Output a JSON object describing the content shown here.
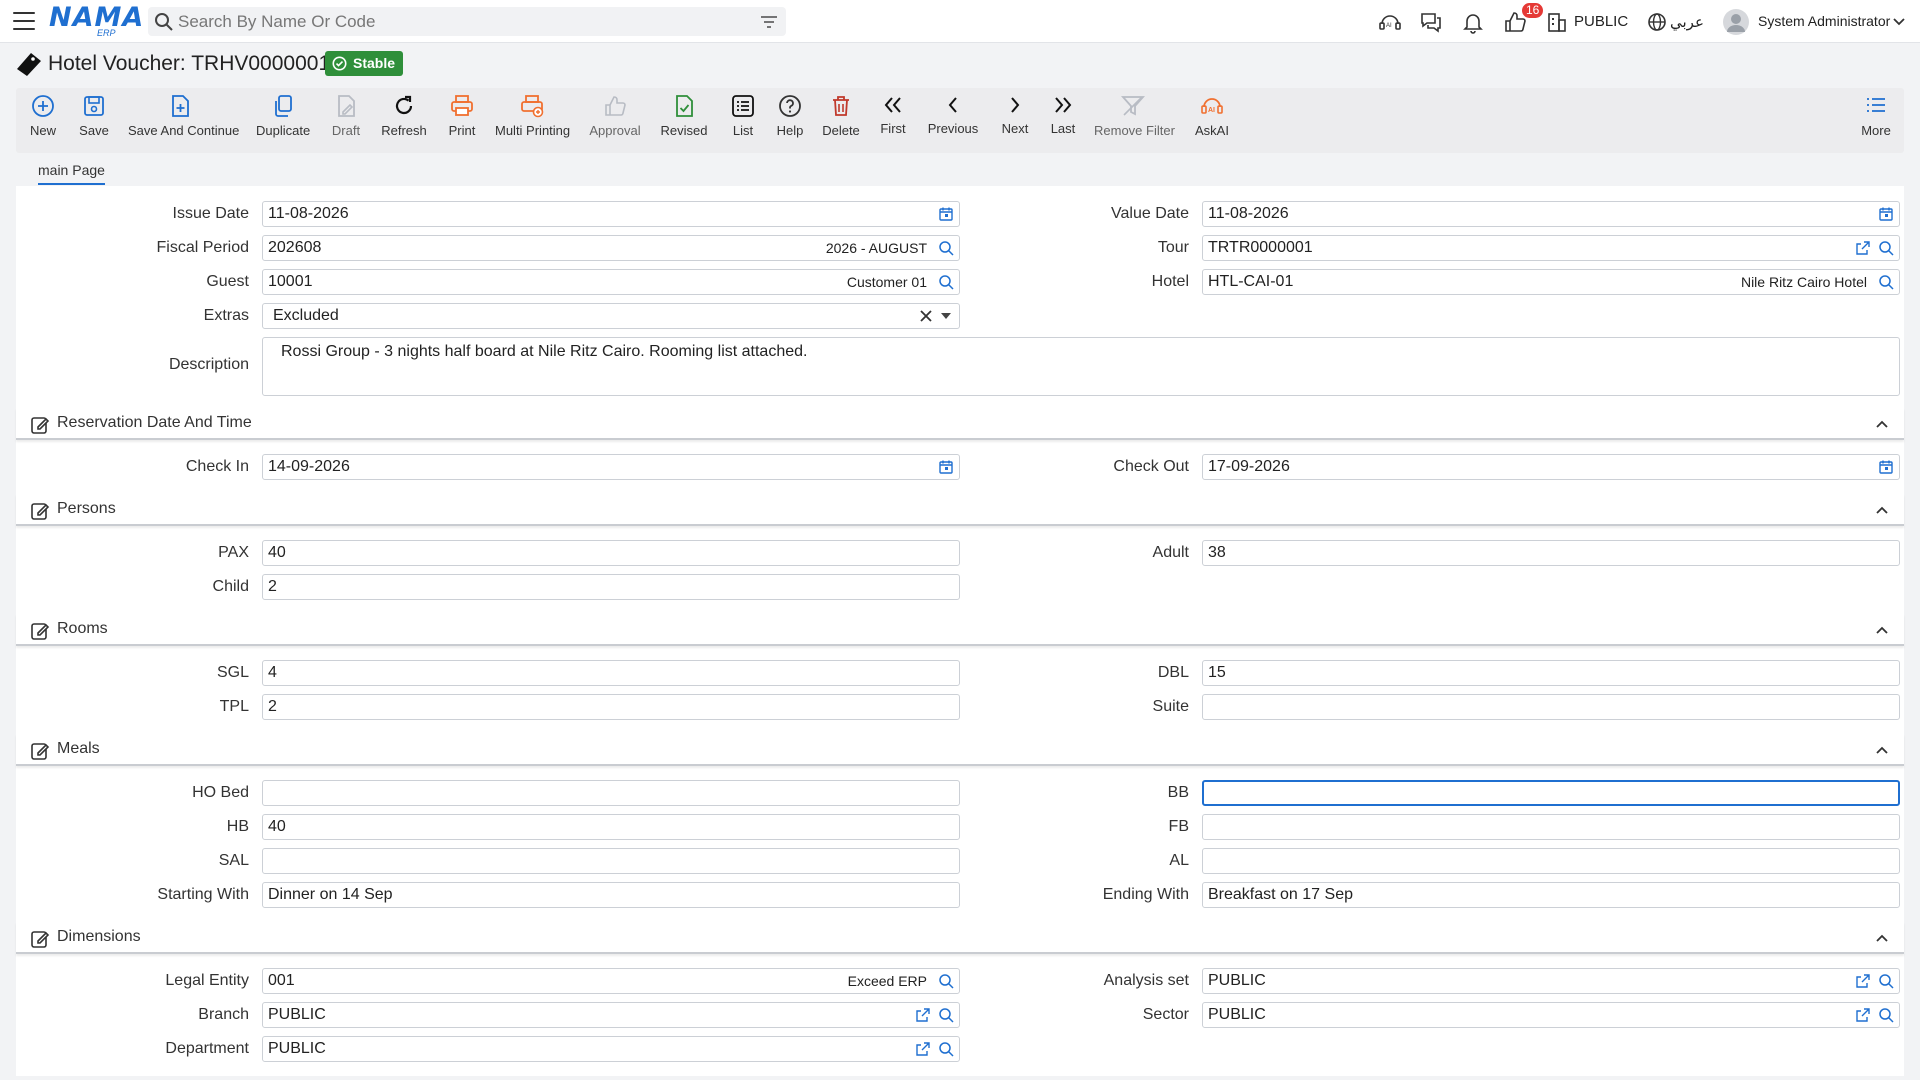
{
  "header": {
    "logo_text": "NAMA",
    "logo_sub": "ERP",
    "search_placeholder": "Search By Name Or Code",
    "notification_count": "16",
    "analysis_set_label": "PUBLIC",
    "language_label": "عربي",
    "user_name": "System Administrator"
  },
  "page": {
    "title": "Hotel Voucher: TRHV0000001",
    "status": "Stable"
  },
  "toolbar": {
    "new": "New",
    "save": "Save",
    "save_continue": "Save And Continue",
    "duplicate": "Duplicate",
    "draft": "Draft",
    "refresh": "Refresh",
    "print": "Print",
    "multi_printing": "Multi Printing",
    "approval": "Approval",
    "revised": "Revised",
    "list": "List",
    "help": "Help",
    "delete": "Delete",
    "first": "First",
    "previous": "Previous",
    "next": "Next",
    "last": "Last",
    "remove_filter": "Remove Filter",
    "askai": "AskAI",
    "more": "More"
  },
  "tabs": {
    "main": "main Page"
  },
  "general": {
    "issue_date_label": "Issue Date",
    "issue_date": "11-08-2026",
    "value_date_label": "Value Date",
    "value_date": "11-08-2026",
    "fiscal_period_label": "Fiscal Period",
    "fiscal_period": "202608",
    "fiscal_period_name": "2026 - AUGUST",
    "tour_label": "Tour",
    "tour": "TRTR0000001",
    "guest_label": "Guest",
    "guest": "10001",
    "guest_name": "Customer 01",
    "hotel_label": "Hotel",
    "hotel": "HTL-CAI-01",
    "hotel_name": "Nile Ritz Cairo Hotel",
    "extras_label": "Extras",
    "extras": "Excluded",
    "description_label": "Description",
    "description": "Rossi Group - 3 nights half board at Nile Ritz Cairo. Rooming list attached."
  },
  "reservation": {
    "title": "Reservation Date And Time",
    "check_in_label": "Check In",
    "check_in": "14-09-2026",
    "check_out_label": "Check Out",
    "check_out": "17-09-2026"
  },
  "persons": {
    "title": "Persons",
    "pax_label": "PAX",
    "pax": "40",
    "adult_label": "Adult",
    "adult": "38",
    "child_label": "Child",
    "child": "2"
  },
  "rooms": {
    "title": "Rooms",
    "sgl_label": "SGL",
    "sgl": "4",
    "dbl_label": "DBL",
    "dbl": "15",
    "tpl_label": "TPL",
    "tpl": "2",
    "suite_label": "Suite",
    "suite": ""
  },
  "meals": {
    "title": "Meals",
    "ho_bed_label": "HO Bed",
    "ho_bed": "",
    "bb_label": "BB",
    "bb": "",
    "hb_label": "HB",
    "hb": "40",
    "fb_label": "FB",
    "fb": "",
    "sal_label": "SAL",
    "sal": "",
    "al_label": "AL",
    "al": "",
    "starting_with_label": "Starting With",
    "starting_with": "Dinner on 14 Sep",
    "ending_with_label": "Ending With",
    "ending_with": "Breakfast on 17 Sep"
  },
  "dimensions": {
    "title": "Dimensions",
    "legal_entity_label": "Legal Entity",
    "legal_entity": "001",
    "legal_entity_name": "Exceed ERP",
    "analysis_set_label": "Analysis set",
    "analysis_set": "PUBLIC",
    "branch_label": "Branch",
    "branch": "PUBLIC",
    "sector_label": "Sector",
    "sector": "PUBLIC",
    "department_label": "Department",
    "department": "PUBLIC"
  },
  "colors": {
    "accent": "#1f6fd0",
    "success": "#2f8f3a",
    "danger": "#e53935",
    "print": "#f07030"
  }
}
